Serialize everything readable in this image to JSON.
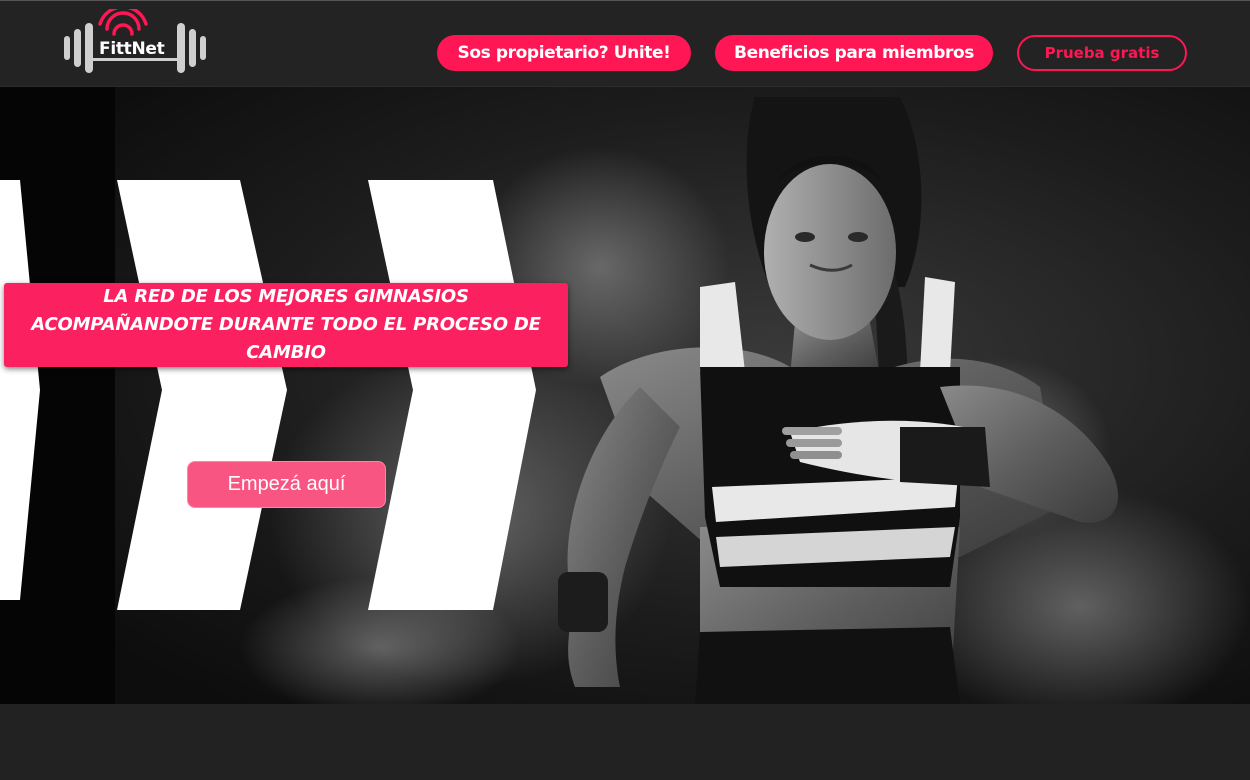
{
  "brand": {
    "name": "FittNet",
    "accent_color": "#ff1654",
    "logo_icons": [
      "dumbbell-icon",
      "wifi-icon"
    ]
  },
  "nav": {
    "owner_label": "Sos propietario? Unite!",
    "benefits_label": "Beneficios para miembros",
    "trial_label": "Prueba gratis"
  },
  "hero": {
    "headline": "LA RED DE LOS MEJORES GIMNASIOS ACOMPAÑANDOTE DURANTE TODO EL PROCESO DE CAMBIO",
    "cta_label": "Empezá aquí",
    "headline_bg": "#fb2060",
    "cta_bg": "#f85583"
  }
}
